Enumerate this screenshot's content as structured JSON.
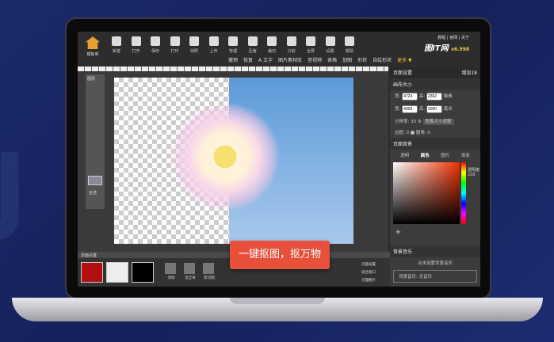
{
  "toolbar": {
    "home": "模板库",
    "tools": [
      "新建",
      "打开",
      "保存",
      "打印",
      "快照",
      "上传",
      "管理",
      "压缩",
      "裁切",
      "分割",
      "全屏",
      "设置",
      "帮助"
    ],
    "row2": [
      "撤销",
      "恢复",
      "A 文字",
      "图片素材库",
      "音视频",
      "表格",
      "划图",
      "形状",
      "自绘形状",
      "更多 ▼"
    ]
  },
  "links": "教程 | 官网 | 关于",
  "logo": "图IT网",
  "version": "v6.998",
  "layers": {
    "title": "图层",
    "item": "全选"
  },
  "panel": {
    "title": "页面设置",
    "extra": "增加18",
    "canvas_size": "画布大小",
    "width_label": "宽:",
    "width_px": "4724",
    "height_label": "高:",
    "height_px": "2362",
    "unit_px": "像素",
    "width_mm": "4000",
    "height_mm": "2000",
    "unit_mm": "毫米",
    "dpi_label": "分辨率:",
    "dpi": "30",
    "resize": "图像大小调整",
    "border_label": "边框:",
    "border": "0",
    "radius_label": "圆角:",
    "radius": "0",
    "bg": "页面背景",
    "bg_tabs": [
      "透明",
      "颜色",
      "图片",
      "渐变"
    ],
    "alpha": "透明度",
    "alpha_val": "100",
    "music": "背景音乐",
    "music_hint": "点击设置背景音乐",
    "music_field": "背景音乐: 无音乐"
  },
  "bottom": {
    "title": "页面设置",
    "actions": [
      "添加",
      "设全背",
      "影切图"
    ],
    "side": [
      "页面设置",
      "适合窗口",
      "页面图片"
    ]
  },
  "toast": "一键抠图，抠万物"
}
